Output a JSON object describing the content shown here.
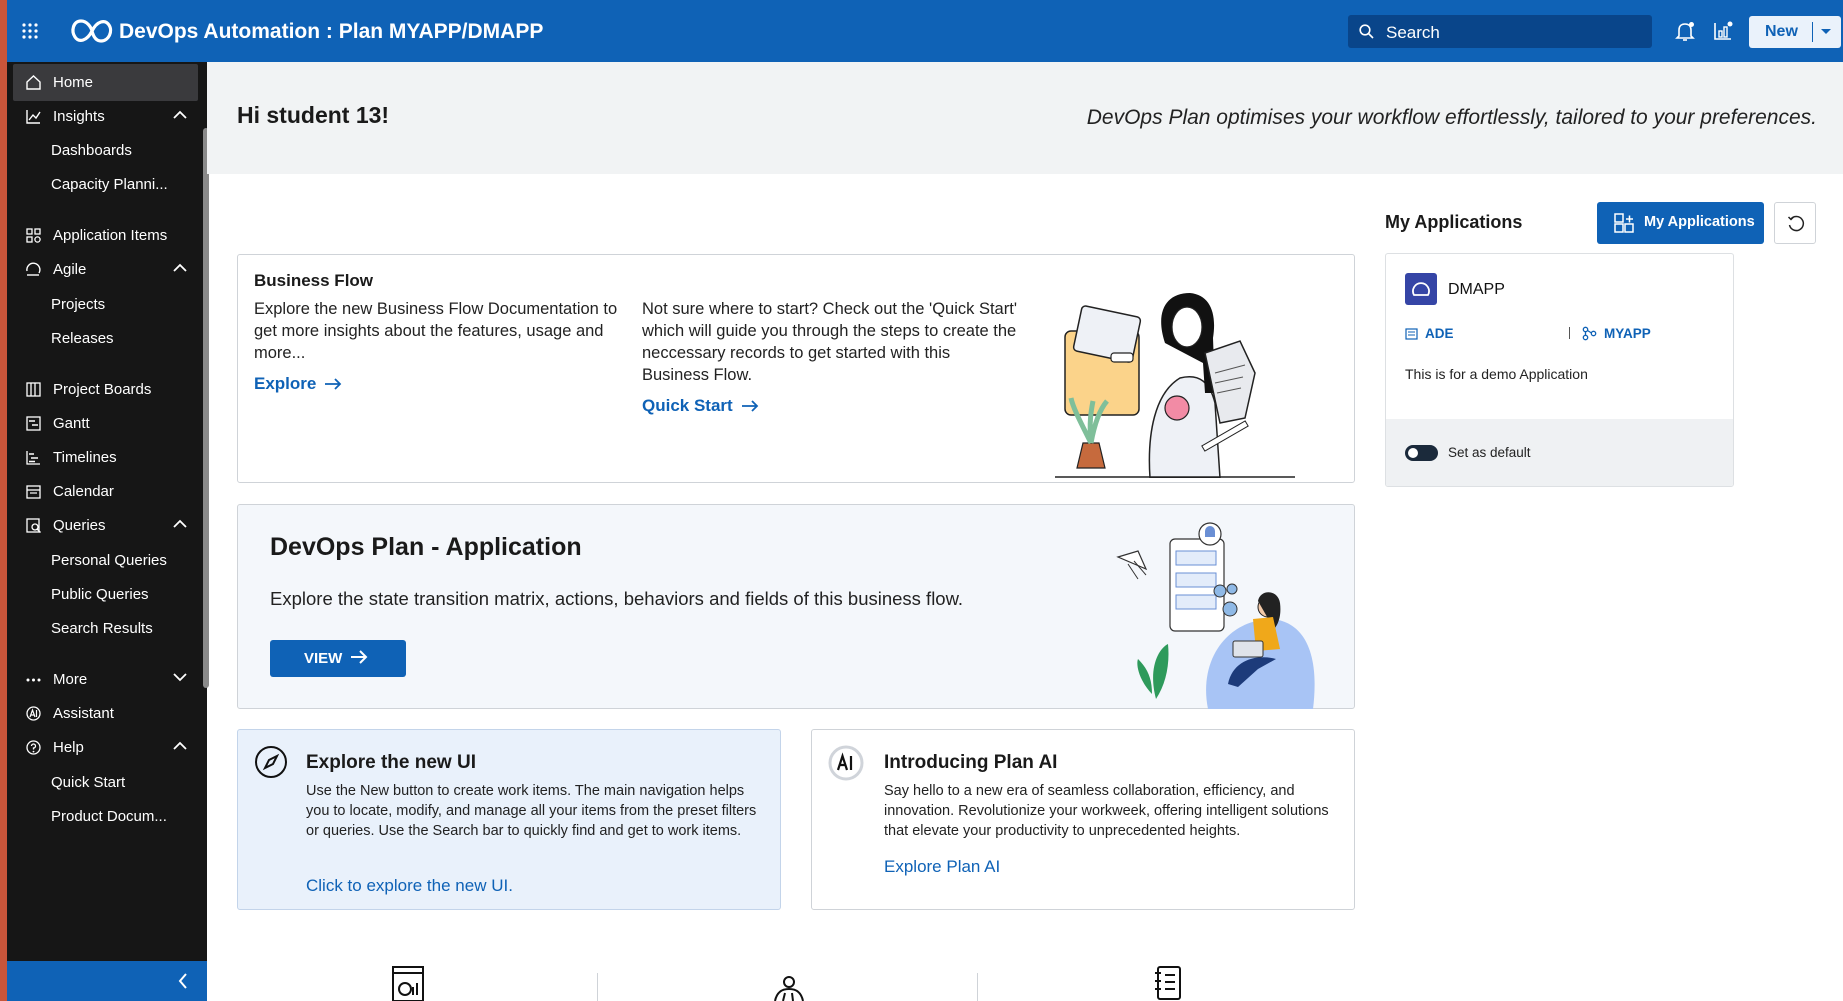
{
  "header": {
    "app_title": "DevOps Automation : Plan MYAPP/DMAPP",
    "search_placeholder": "Search",
    "new_label": "New"
  },
  "sidebar": {
    "items": [
      {
        "label": "Home",
        "icon": "home-icon"
      },
      {
        "label": "Insights",
        "icon": "chart-line-icon"
      },
      {
        "label": "Dashboards"
      },
      {
        "label": "Capacity Planni..."
      },
      {
        "label": "Application Items",
        "icon": "grid-items-icon"
      },
      {
        "label": "Agile",
        "icon": "agile-icon"
      },
      {
        "label": "Projects"
      },
      {
        "label": "Releases"
      },
      {
        "label": "Project Boards",
        "icon": "board-icon"
      },
      {
        "label": "Gantt",
        "icon": "gantt-icon"
      },
      {
        "label": "Timelines",
        "icon": "timeline-icon"
      },
      {
        "label": "Calendar",
        "icon": "calendar-icon"
      },
      {
        "label": "Queries",
        "icon": "query-icon"
      },
      {
        "label": "Personal Queries"
      },
      {
        "label": "Public Queries"
      },
      {
        "label": "Search Results"
      },
      {
        "label": "More",
        "icon": "more-icon"
      },
      {
        "label": "Assistant",
        "icon": "ai-icon"
      },
      {
        "label": "Help",
        "icon": "help-icon"
      },
      {
        "label": "Quick Start"
      },
      {
        "label": "Product Docum..."
      }
    ]
  },
  "hero": {
    "greeting": "Hi student 13!",
    "tagline": "DevOps Plan optimises your workflow effortlessly, tailored to your preferences."
  },
  "business_flow": {
    "title": "Business Flow",
    "text_left": "Explore the new Business Flow Documentation to get more insights about the features, usage and more...",
    "explore_link": "Explore",
    "text_right": "Not sure where to start? Check out the 'Quick Start' which will guide you through the steps to create the neccessary records to get started with this Business Flow.",
    "quick_start_link": "Quick Start"
  },
  "devops_app": {
    "title": "DevOps Plan - Application",
    "text": "Explore the state transition matrix, actions, behaviors and fields of this business flow.",
    "view_label": "VIEW"
  },
  "explore_ui": {
    "title": "Explore the new UI",
    "text": "Use the New button to create work items. The main navigation helps you to locate, modify, and manage all your items from the preset filters or queries. Use the Search bar to quickly find and get to work items.",
    "link": "Click to explore the new UI."
  },
  "plan_ai": {
    "title": "Introducing Plan AI",
    "text": "Say hello to a new era of seamless collaboration, efficiency, and innovation. Revolutionize your workweek, offering intelligent solutions that elevate your productivity to unprecedented heights.",
    "link": "Explore Plan AI"
  },
  "my_apps": {
    "title": "My Applications",
    "button_label": "My Applications",
    "app_name": "DMAPP",
    "tag1": "ADE",
    "tag2": "MYAPP",
    "description": "This is for a demo Application",
    "default_label": "Set as default",
    "default_on": false
  },
  "colors": {
    "primary": "#0f62b6",
    "sidebar_bg": "#161616",
    "hero_bg": "#f1f3f4",
    "badge": "#3545a6"
  }
}
